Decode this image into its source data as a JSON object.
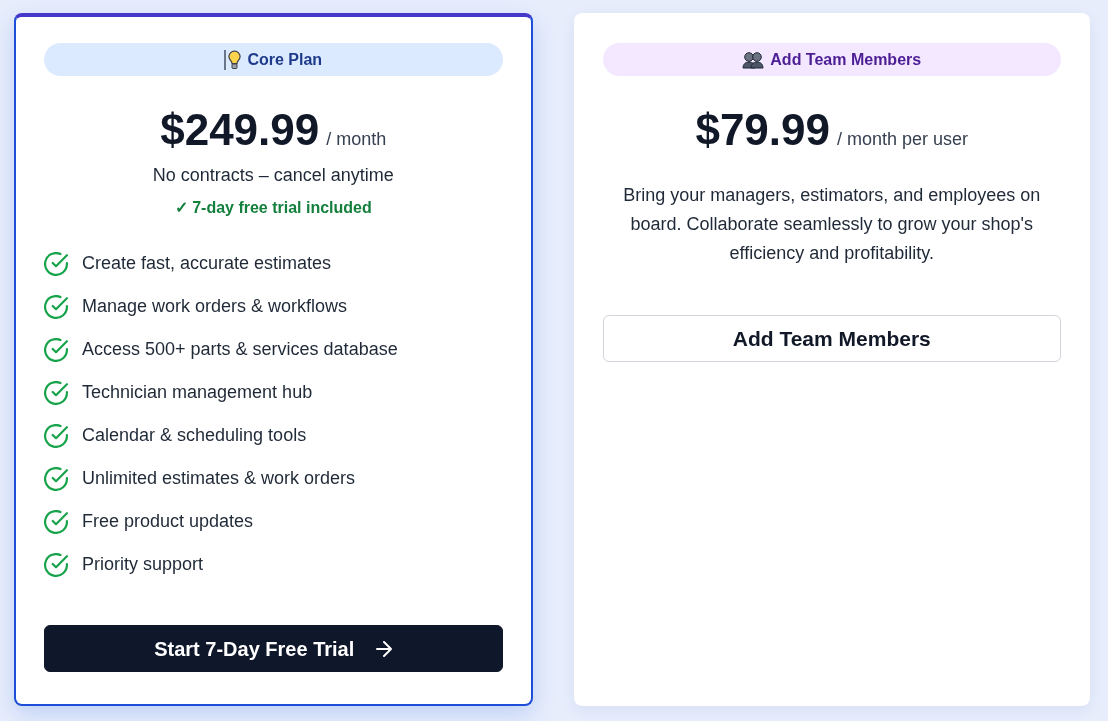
{
  "plans": [
    {
      "kind": "core",
      "highlighted": true,
      "badge": "Core Plan",
      "price": "$249.99",
      "period": "/ month",
      "note": "No contracts – cancel anytime",
      "trial": "✓ 7-day free trial included",
      "features": [
        "Create fast, accurate estimates",
        "Manage work orders & workflows",
        "Access 500+ parts & services database",
        "Technician management hub",
        "Calendar & scheduling tools",
        "Unlimited estimates & work orders",
        "Free product updates",
        "Priority support"
      ],
      "button": {
        "kind": "primary",
        "label": "Start 7-Day Free Trial"
      }
    },
    {
      "kind": "addon",
      "highlighted": false,
      "badge": "Add Team Members",
      "price": "$79.99",
      "period": "/ month per user",
      "description": "Bring your managers, estimators, and employees on board. Collaborate seamlessly to grow your shop's efficiency and profitability.",
      "button": {
        "kind": "outline",
        "label": "Add Team Members"
      }
    }
  ]
}
